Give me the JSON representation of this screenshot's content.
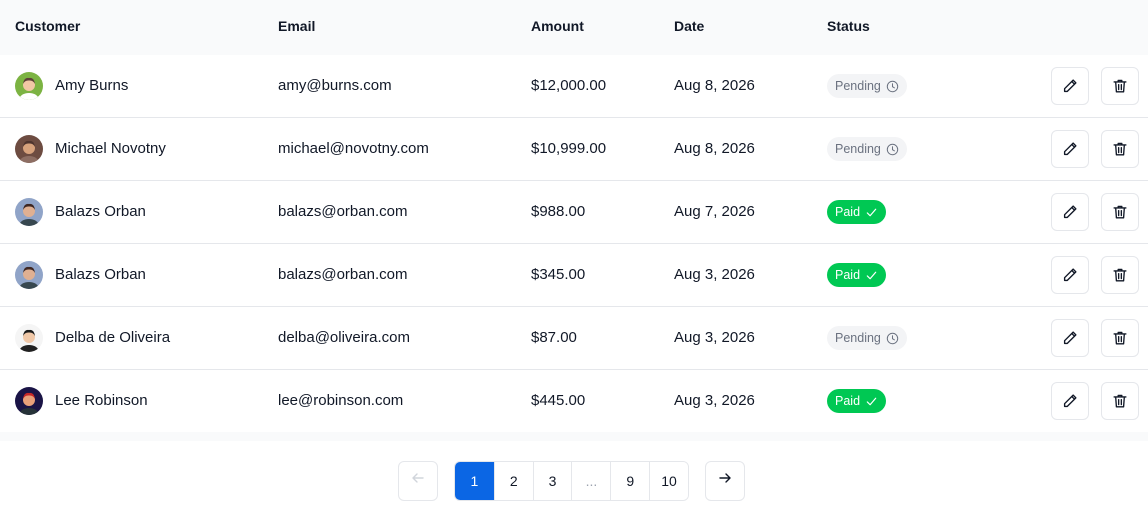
{
  "table": {
    "headers": {
      "customer": "Customer",
      "email": "Email",
      "amount": "Amount",
      "date": "Date",
      "status": "Status"
    },
    "rows": [
      {
        "name": "Amy Burns",
        "email": "amy@burns.com",
        "amount": "$12,000.00",
        "date": "Aug 8, 2026",
        "status": "Pending",
        "status_type": "pending"
      },
      {
        "name": "Michael Novotny",
        "email": "michael@novotny.com",
        "amount": "$10,999.00",
        "date": "Aug 8, 2026",
        "status": "Pending",
        "status_type": "pending"
      },
      {
        "name": "Balazs Orban",
        "email": "balazs@orban.com",
        "amount": "$988.00",
        "date": "Aug 7, 2026",
        "status": "Paid",
        "status_type": "paid"
      },
      {
        "name": "Balazs Orban",
        "email": "balazs@orban.com",
        "amount": "$345.00",
        "date": "Aug 3, 2026",
        "status": "Paid",
        "status_type": "paid"
      },
      {
        "name": "Delba de Oliveira",
        "email": "delba@oliveira.com",
        "amount": "$87.00",
        "date": "Aug 3, 2026",
        "status": "Pending",
        "status_type": "pending"
      },
      {
        "name": "Lee Robinson",
        "email": "lee@robinson.com",
        "amount": "$445.00",
        "date": "Aug 3, 2026",
        "status": "Paid",
        "status_type": "paid"
      }
    ]
  },
  "pagination": {
    "pages": [
      "1",
      "2",
      "3",
      "...",
      "9",
      "10"
    ],
    "current": "1"
  },
  "icons": {
    "pending": "clock-icon",
    "paid": "check-icon",
    "edit": "pencil-icon",
    "delete": "trash-icon",
    "prev": "arrow-left-icon",
    "next": "arrow-right-icon"
  },
  "colors": {
    "paid_badge": "#00c853",
    "pending_badge": "#f3f4f6",
    "active_page": "#0b66e4"
  }
}
